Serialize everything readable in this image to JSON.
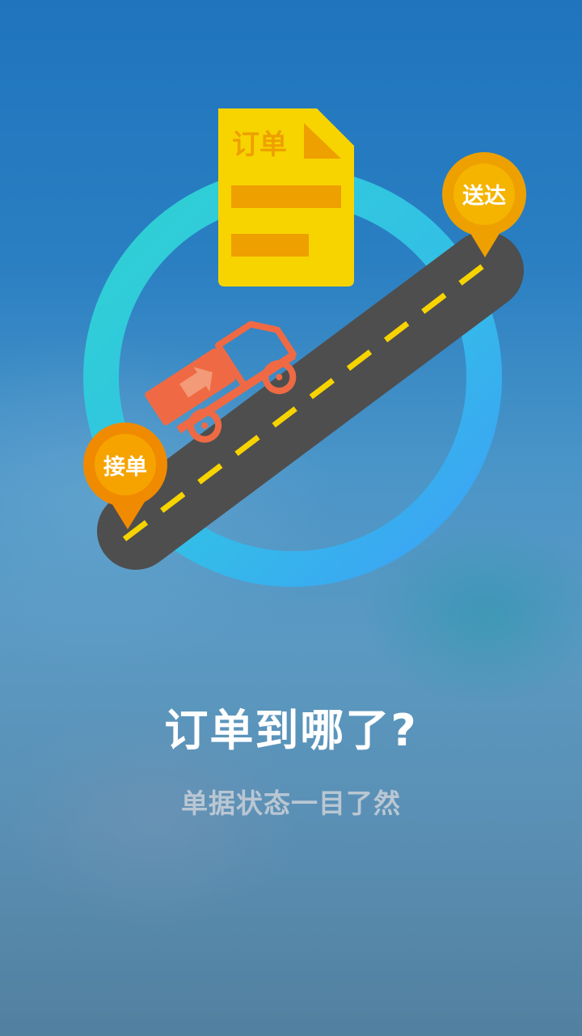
{
  "illustration": {
    "document_label": "订单",
    "pin_start_label": "接单",
    "pin_end_label": "送达"
  },
  "onboarding": {
    "title": "订单到哪了?",
    "subtitle": "单据状态一目了然"
  },
  "colors": {
    "ring_gradient_start": "#2ecfd4",
    "ring_gradient_end": "#3aa8f4",
    "road": "#4e4e4e",
    "road_dash": "#f7d400",
    "document": "#f7d400",
    "document_accent": "#f0a000",
    "truck": "#ef6a44",
    "pin_start": "#f08a00",
    "pin_end": "#f0a000"
  }
}
